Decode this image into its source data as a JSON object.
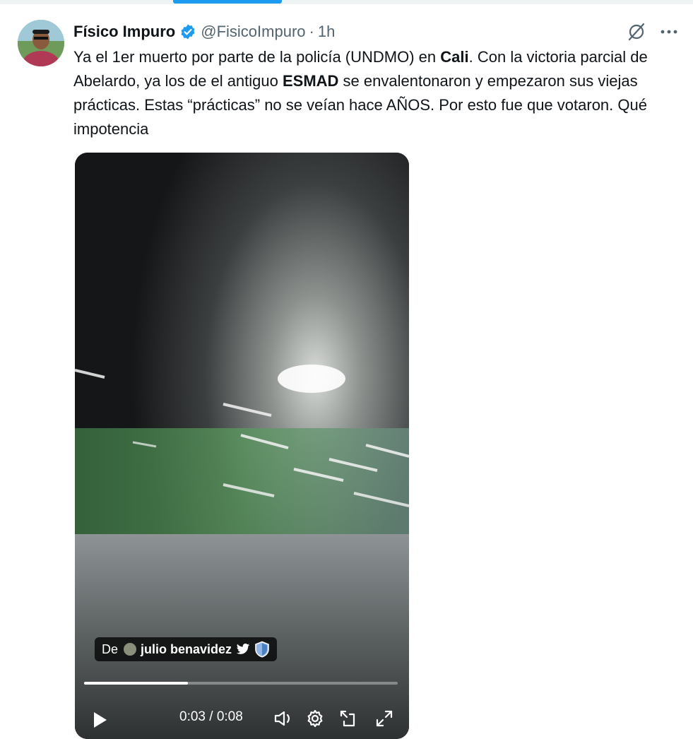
{
  "tweet": {
    "display_name": "Físico Impuro",
    "handle": "@FisicoImpuro",
    "separator": "·",
    "time": "1h",
    "text_parts": [
      {
        "text": "Ya el 1er muerto por parte de la policía (UNDMO) en ",
        "bold": false
      },
      {
        "text": "Cali",
        "bold": true
      },
      {
        "text": ". Con la victoria parcial de Abelardo, ya los de el antiguo ",
        "bold": false
      },
      {
        "text": "ESMAD",
        "bold": true
      },
      {
        "text": " se envalentonaron y empezaron sus viejas prácticas. Estas “prácticas”  no se veían hace AÑOS. Por esto fue que votaron. Qué impotencia",
        "bold": false
      }
    ]
  },
  "video": {
    "attribution_prefix": "De",
    "attribution_name": "julio benavidez",
    "current_time": "0:03",
    "time_separator": " / ",
    "duration": "0:08",
    "progress_fraction": 0.33
  },
  "colors": {
    "accent": "#1d9bf0",
    "text_primary": "#0f1419",
    "text_secondary": "#536471"
  },
  "icons": {
    "verified": "verified-badge-icon",
    "grok": "grok-icon",
    "more": "more-options-icon",
    "play": "play-icon",
    "volume": "volume-icon",
    "settings": "settings-icon",
    "fullscreen_alt": "picture-in-picture-icon",
    "expand": "expand-icon"
  }
}
